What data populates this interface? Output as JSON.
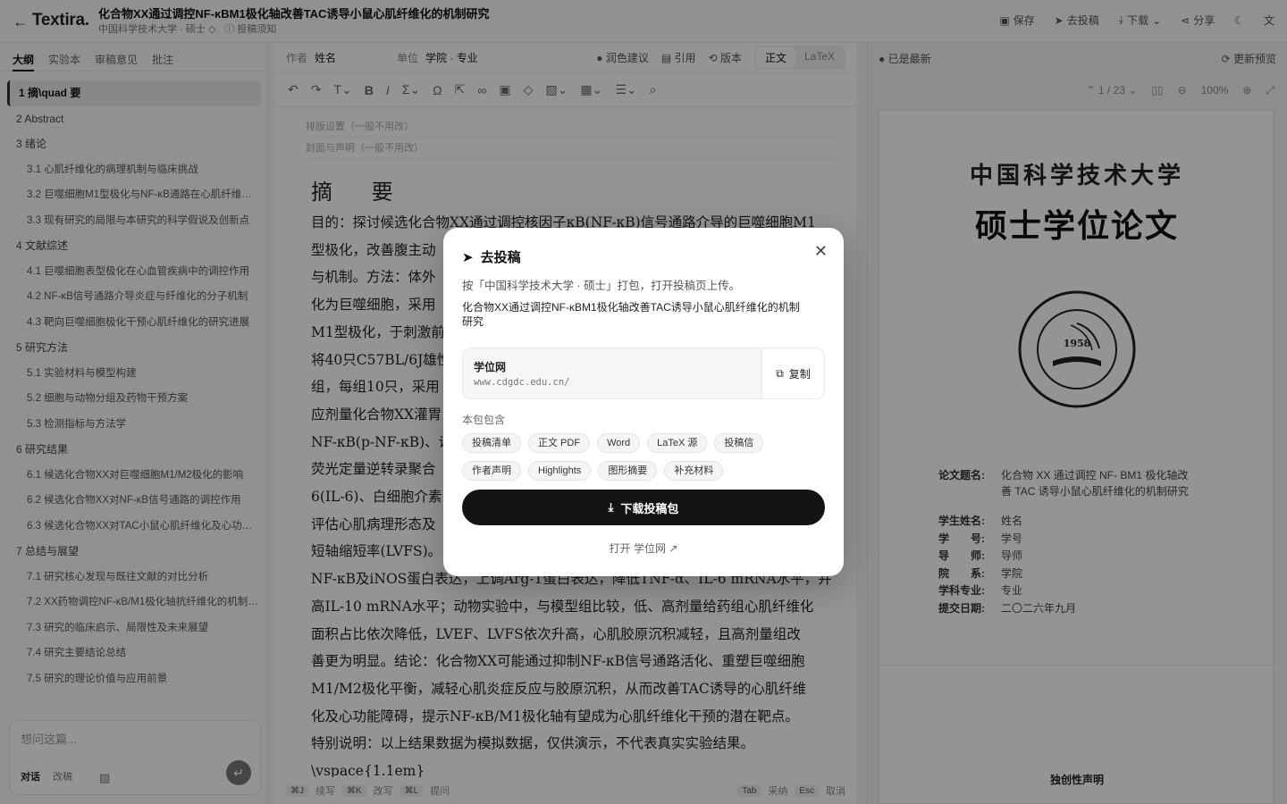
{
  "topbar": {
    "logo": "Textira.",
    "title": "化合物XX通过调控NF-κBM1极化轴改善TAC诱导小鼠心肌纤维化的机制研究",
    "school": "中国科学技术大学 · 硕士 ◇",
    "notice": "投稿须知",
    "actions": {
      "save": "保存",
      "submit": "去投稿",
      "download": "下载",
      "share": "分享"
    }
  },
  "left": {
    "tabs": [
      "大纲",
      "实验本",
      "审稿意见",
      "批注"
    ],
    "outline": [
      {
        "label": "1 摘\\quad 要",
        "level": 1,
        "selected": true
      },
      {
        "label": "2 Abstract",
        "level": 1
      },
      {
        "label": "3 绪论",
        "level": 1
      },
      {
        "label": "3.1 心肌纤维化的病理机制与临床挑战",
        "level": 2
      },
      {
        "label": "3.2 巨噬细胞M1型极化与NF-κB通路在心肌纤维化中的作用",
        "level": 2
      },
      {
        "label": "3.3 现有研究的局限与本研究的科学假说及创新点",
        "level": 2
      },
      {
        "label": "4 文献综述",
        "level": 1
      },
      {
        "label": "4.1 巨噬细胞表型极化在心血管疾病中的调控作用",
        "level": 2
      },
      {
        "label": "4.2 NF-κB信号通路介导炎症与纤维化的分子机制",
        "level": 2
      },
      {
        "label": "4.3 靶向巨噬细胞极化干预心肌纤维化的研究进展",
        "level": 2
      },
      {
        "label": "5 研究方法",
        "level": 1
      },
      {
        "label": "5.1 实验材料与模型构建",
        "level": 2
      },
      {
        "label": "5.2 细胞与动物分组及药物干预方案",
        "level": 2
      },
      {
        "label": "5.3 检测指标与方法学",
        "level": 2
      },
      {
        "label": "6 研究结果",
        "level": 1
      },
      {
        "label": "6.1 候选化合物XX对巨噬细胞M1/M2极化的影响",
        "level": 2
      },
      {
        "label": "6.2 候选化合物XX对NF-κB信号通路的调控作用",
        "level": 2
      },
      {
        "label": "6.3 候选化合物XX对TAC小鼠心肌纤维化及心功能的改善",
        "level": 2
      },
      {
        "label": "7 总结与展望",
        "level": 1
      },
      {
        "label": "7.1 研究核心发现与既往文献的对比分析",
        "level": 2
      },
      {
        "label": "7.2 XX药物调控NF-κB/M1极化轴抗纤维化的机制阐释",
        "level": 2
      },
      {
        "label": "7.3 研究的临床启示、局限性及未来展望",
        "level": 2
      },
      {
        "label": "7.4 研究主要结论总结",
        "level": 2
      },
      {
        "label": "7.5 研究的理论价值与应用前景",
        "level": 2
      }
    ],
    "ask": {
      "placeholder": "想问这篇...",
      "mode_chat": "对话",
      "mode_edit": "改稿"
    }
  },
  "editor": {
    "author_label": "作者",
    "author_value": "姓名",
    "unit_label": "单位",
    "unit_value": "学院 · 专业",
    "polish": "润色建议",
    "cite": "引用",
    "version": "版本",
    "view_body": "正文",
    "view_latex": "LaTeX",
    "layout_settings": "排版设置（一般不用改）",
    "cover_settings": "封面与声明（一般不用改）",
    "heading": "摘  要",
    "paragraphs": [
      "目的：探讨候选化合物XX通过调控核因子κB(NF-κB)信号通路介导的巨噬细胞M1",
      "型极化，改善腹主动",
      "与机制。方法：体外",
      "化为巨噬细胞，采用",
      "M1型极化，于刺激前",
      "将40只C57BL/6J雄性",
      "组，每组10只，采用",
      "应剂量化合物XX灌胃",
      "NF-κB(p-NF-κB)、诱",
      "荧光定量逆转录聚合",
      "6(IL-6)、白细胞介素",
      "评估心肌病理形态及",
      "短轴缩短率(LVFS)。",
      "NF-κB及iNOS蛋白表达，上调Arg-1蛋白表达，降低TNF-α、IL-6 mRNA水平，并",
      "高IL-10 mRNA水平；动物实验中，与模型组比较，低、高剂量给药组心肌纤维化",
      "面积占比依次降低，LVEF、LVFS依次升高，心肌胶原沉积减轻，且高剂量组改",
      "善更为明显。结论：化合物XX可能通过抑制NF-κB信号通路活化、重塑巨噬细胞",
      "M1/M2极化平衡，减轻心肌炎症反应与胶原沉积，从而改善TAC诱导的心肌纤维",
      "化及心功能障碍，提示NF-κB/M1极化轴有望成为心肌纤维化干预的潜在靶点。",
      "特别说明：以上结果数据为模拟数据，仅供演示，不代表真实实验结果。",
      "\\vspace{1.1em}"
    ],
    "status": {
      "k1": "⌘J",
      "a1": "续写",
      "k2": "⌘K",
      "a2": "改写",
      "k3": "⌘L",
      "a3": "提问",
      "k4": "Tab",
      "a4": "采纳",
      "k5": "Esc",
      "a5": "取消"
    }
  },
  "preview": {
    "status": "已是最新",
    "refresh": "更新预览",
    "page_indicator": "1 / 23",
    "zoom": "100%",
    "university": "中国科学技术大学",
    "thesis_type": "硕士学位论文",
    "seal_year": "1958",
    "info": [
      {
        "k": "论文题名:",
        "v": "化合物 XX 通过调控 NF- BM1 极化轴改善 TAC 诱导小鼠心肌纤维化的机制研究"
      },
      {
        "k": "学生姓名:",
        "v": "姓名"
      },
      {
        "k": "学　　号:",
        "v": "学号"
      },
      {
        "k": "导　　师:",
        "v": "导师"
      },
      {
        "k": "院　　系:",
        "v": "学院"
      },
      {
        "k": "学科专业:",
        "v": "专业"
      },
      {
        "k": "提交日期:",
        "v": "二〇二六年九月"
      }
    ],
    "declaration": "独创性声明"
  },
  "modal": {
    "title": "去投稿",
    "desc": "按「中国科学技术大学 · 硕士」打包，打开投稿页上传。",
    "doc_title": "化合物XX通过调控NF-κBM1极化轴改善TAC诱导小鼠心肌纤维化的机制研究",
    "site_name": "学位网",
    "site_url": "www.cdgdc.edu.cn/",
    "copy": "复制",
    "includes_label": "本包包含",
    "chips": [
      "投稿清单",
      "正文 PDF",
      "Word",
      "LaTeX 源",
      "投稿信",
      "作者声明",
      "Highlights",
      "图形摘要",
      "补充材料"
    ],
    "download": "下载投稿包",
    "open_link": "打开 学位网"
  }
}
